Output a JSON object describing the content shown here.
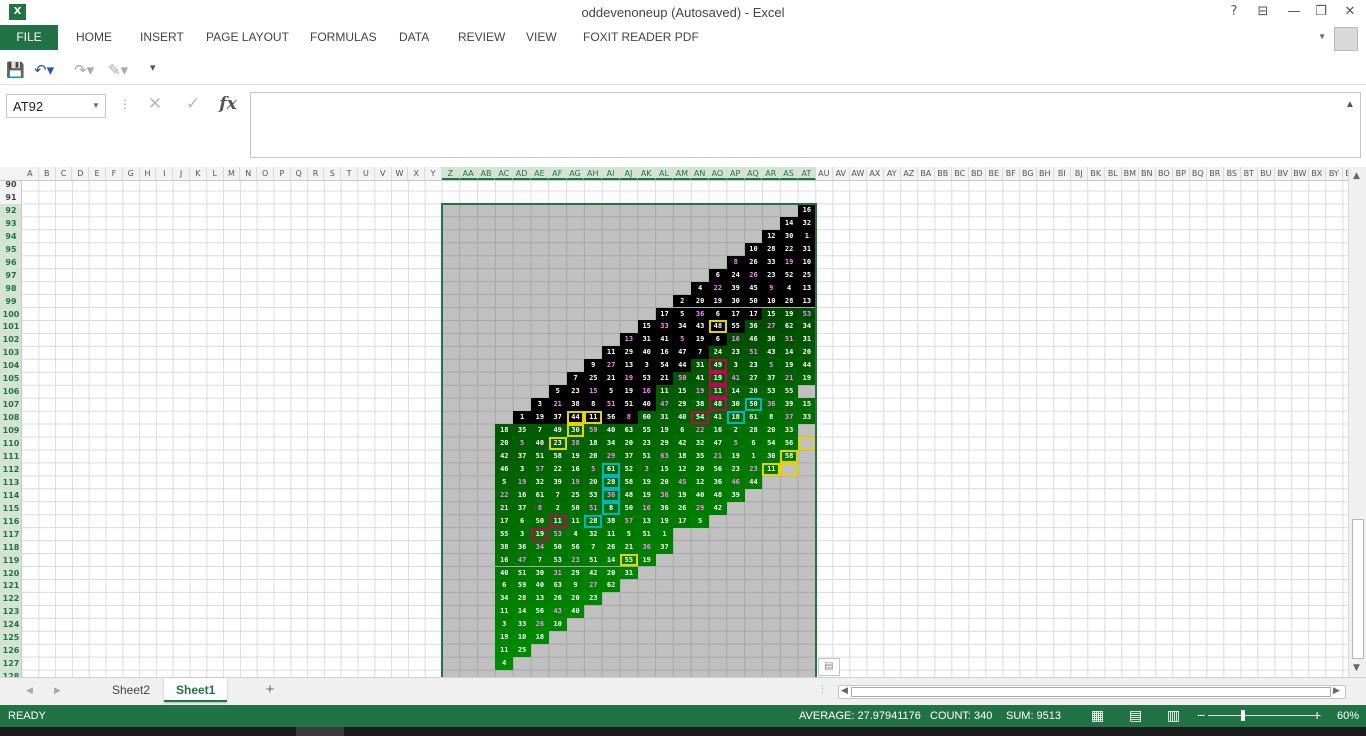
{
  "window": {
    "title": "oddevenoneup (Autosaved) - Excel",
    "help": "?",
    "restore_ribbon": "⊟",
    "minimize": "—",
    "maximize": "❐",
    "close": "✕"
  },
  "ribbon": {
    "file_label": "FILE",
    "tabs": [
      "HOME",
      "INSERT",
      "PAGE LAYOUT",
      "FORMULAS",
      "DATA",
      "REVIEW",
      "VIEW",
      "FOXIT READER PDF"
    ]
  },
  "qat": {
    "save_icon": "save-icon",
    "undo_icon": "undo-icon",
    "redo_icon": "redo-icon",
    "customize_icon": "customize-icon"
  },
  "formula_bar": {
    "name_box": "AT92",
    "cancel": "✕",
    "enter": "✓",
    "fx": "fx",
    "content": ""
  },
  "grid": {
    "columns": [
      "A",
      "B",
      "C",
      "D",
      "E",
      "F",
      "G",
      "H",
      "I",
      "J",
      "K",
      "L",
      "M",
      "N",
      "O",
      "P",
      "Q",
      "R",
      "S",
      "T",
      "U",
      "V",
      "W",
      "X",
      "Y",
      "Z",
      "AA",
      "AB",
      "AC",
      "AD",
      "AE",
      "AF",
      "AG",
      "AH",
      "AI",
      "AJ",
      "AK",
      "AL",
      "AM",
      "AN",
      "AO",
      "AP",
      "AQ",
      "AR",
      "AS",
      "AT",
      "AU",
      "AV",
      "AW",
      "AX",
      "AY",
      "AZ",
      "BA",
      "BB",
      "BC",
      "BD",
      "BE",
      "BF",
      "BG",
      "BH",
      "BI",
      "BJ",
      "BK",
      "BL",
      "BM",
      "BN",
      "BO",
      "BP",
      "BQ",
      "BR",
      "BS",
      "BT",
      "BU",
      "BV",
      "BW",
      "BX",
      "BY",
      "BZ"
    ],
    "first_row": 90,
    "row_count": 40,
    "selected_first_col": 25,
    "selected_last_col": 45,
    "selected_first_row": 92,
    "selected_last_row": 128,
    "rows": [
      [
        "16"
      ],
      [
        "14",
        "32"
      ],
      [
        "12",
        "30",
        "1"
      ],
      [
        "10",
        "28",
        "22",
        "31"
      ],
      [
        "8",
        "26",
        "33",
        "19",
        "10"
      ],
      [
        "6",
        "24",
        "26",
        "23",
        "52",
        "25"
      ],
      [
        "4",
        "22",
        "39",
        "45",
        "9",
        "4",
        "13"
      ],
      [
        "2",
        "20",
        "19",
        "30",
        "50",
        "10",
        "28",
        "13"
      ],
      [
        "17",
        "5",
        "36",
        "6",
        "17",
        "17",
        "15",
        "19",
        "53"
      ],
      [
        "15",
        "33",
        "34",
        "43",
        "48",
        "55",
        "36",
        "27",
        "62",
        "34"
      ],
      [
        "13",
        "31",
        "41",
        "5",
        "19",
        "6",
        "16",
        "46",
        "36",
        "51",
        "31"
      ],
      [
        "11",
        "29",
        "40",
        "16",
        "47",
        "7",
        "24",
        "23",
        "51",
        "43",
        "14",
        "20"
      ],
      [
        "9",
        "27",
        "13",
        "3",
        "54",
        "44",
        "31",
        "49",
        "3",
        "23",
        "5",
        "19",
        "44"
      ],
      [
        "7",
        "25",
        "21",
        "19",
        "53",
        "21",
        "50",
        "41",
        "19",
        "41",
        "27",
        "37",
        "21",
        "19"
      ],
      [
        "5",
        "23",
        "15",
        "5",
        "19",
        "16",
        "11",
        "15",
        "19",
        "11",
        "14",
        "20",
        "53",
        "55"
      ],
      [
        "3",
        "21",
        "38",
        "8",
        "51",
        "51",
        "40",
        "47",
        "29",
        "38",
        "48",
        "30",
        "50",
        "36",
        "39",
        "15"
      ],
      [
        "1",
        "19",
        "37",
        "44",
        "11",
        "56",
        "8",
        "60",
        "31",
        "40",
        "54",
        "41",
        "18",
        "61",
        "8",
        "37",
        "33"
      ],
      [
        "18",
        "35",
        "7",
        "49",
        "30",
        "59",
        "40",
        "63",
        "55",
        "19",
        "6",
        "22",
        "16",
        "2",
        "28",
        "20",
        "33"
      ],
      [
        "20",
        "5",
        "40",
        "23",
        "38",
        "18",
        "34",
        "20",
        "23",
        "29",
        "42",
        "32",
        "47",
        "5",
        "6",
        "54",
        "56"
      ],
      [
        "42",
        "37",
        "51",
        "58",
        "19",
        "20",
        "29",
        "37",
        "51",
        "63",
        "18",
        "35",
        "21",
        "19",
        "1",
        "30",
        "58"
      ],
      [
        "46",
        "3",
        "57",
        "22",
        "16",
        "5",
        "61",
        "52",
        "3",
        "15",
        "12",
        "20",
        "56",
        "23",
        "23",
        "11"
      ],
      [
        "5",
        "19",
        "32",
        "39",
        "19",
        "20",
        "28",
        "58",
        "19",
        "20",
        "45",
        "12",
        "36",
        "46",
        "44"
      ],
      [
        "22",
        "16",
        "61",
        "7",
        "25",
        "53",
        "36",
        "48",
        "19",
        "36",
        "19",
        "40",
        "48",
        "39"
      ],
      [
        "21",
        "37",
        "8",
        "2",
        "50",
        "51",
        "8",
        "50",
        "16",
        "36",
        "26",
        "29",
        "42"
      ],
      [
        "17",
        "6",
        "50",
        "11",
        "11",
        "28",
        "38",
        "57",
        "13",
        "19",
        "17",
        "5"
      ],
      [
        "55",
        "3",
        "19",
        "53",
        "4",
        "32",
        "11",
        "5",
        "51",
        "1"
      ],
      [
        "38",
        "36",
        "34",
        "50",
        "56",
        "7",
        "26",
        "21",
        "36",
        "37"
      ],
      [
        "16",
        "47",
        "7",
        "53",
        "23",
        "51",
        "14",
        "55",
        "19"
      ],
      [
        "40",
        "51",
        "30",
        "31",
        "29",
        "42",
        "20",
        "31"
      ],
      [
        "6",
        "59",
        "40",
        "63",
        "9",
        "27",
        "62"
      ],
      [
        "34",
        "28",
        "13",
        "26",
        "20",
        "23"
      ],
      [
        "11",
        "14",
        "56",
        "43",
        "40"
      ],
      [
        "3",
        "33",
        "26",
        "10"
      ],
      [
        "19",
        "10",
        "18"
      ],
      [
        "11",
        "25"
      ],
      [
        "4"
      ]
    ]
  },
  "sheets": {
    "tabs": [
      "Sheet2",
      "Sheet1"
    ],
    "active": "Sheet1",
    "add": "+"
  },
  "status": {
    "mode": "READY",
    "average": "AVERAGE: 27.97941176",
    "count": "COUNT: 340",
    "sum": "SUM: 9513",
    "zoom": "60%",
    "zoom_level": 0.6
  },
  "colors": {
    "accent": "#217346",
    "black_cell": "#000000",
    "gray_cell": "#c0c0c0",
    "pink": "#ff88ff",
    "yellow_box": "#e6d200",
    "cyan_box": "#00b4c8",
    "magenta_box": "#c8005a"
  }
}
